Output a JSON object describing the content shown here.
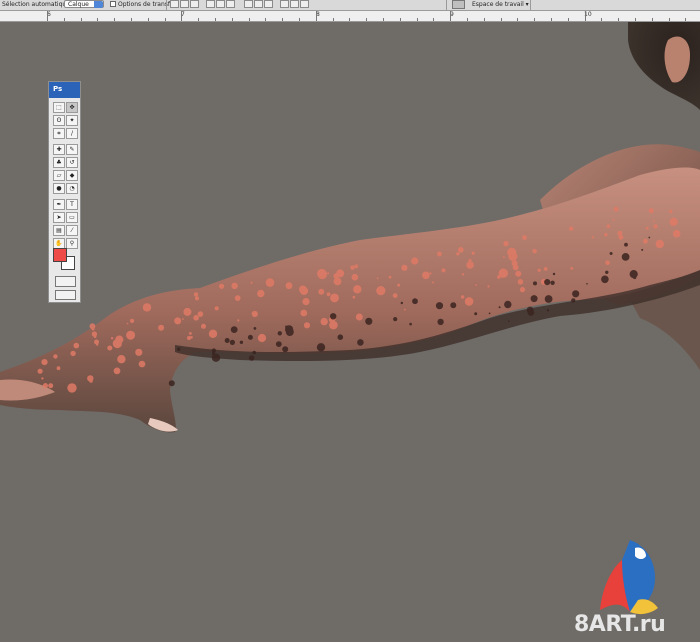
{
  "options_bar": {
    "auto_select_label": "Sélection automatique",
    "auto_select_value": "Calque",
    "transform_options_label": "Options de transf.",
    "workspace_label": "Espace de travail ▾"
  },
  "ruler": {
    "labels": [
      "6",
      "7",
      "8",
      "9",
      "10"
    ]
  },
  "toolbox": {
    "title": "Ps",
    "foreground_color": "#f04c47",
    "background_color": "#ffffff"
  },
  "canvas": {
    "background_color": "#6f6b67",
    "skin_color": "#b07a6a",
    "splatter_color": "#e07a66"
  },
  "watermark": {
    "text": "8ART.ru"
  }
}
